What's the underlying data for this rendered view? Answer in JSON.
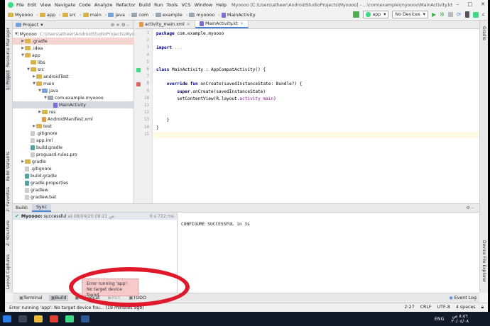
{
  "menubar": {
    "items": [
      "File",
      "Edit",
      "View",
      "Navigate",
      "Code",
      "Analyze",
      "Refactor",
      "Build",
      "Run",
      "Tools",
      "VCS",
      "Window",
      "Help"
    ],
    "title": "Myoooo [C:\\Users\\atheer\\AndroidStudioProjects\\Myoooo] - ...\\com\\example\\myoooo\\MainActivity.kt",
    "controls": [
      "–",
      "□",
      "✕"
    ]
  },
  "navbar": {
    "crumbs": [
      "Myoooo",
      "app",
      "src",
      "main",
      "java",
      "com",
      "example",
      "myoooo",
      "MainActivity"
    ],
    "run_config": "app",
    "device": "No Devices"
  },
  "project_panel": {
    "header": "Project",
    "tree": [
      {
        "label": "Myoooo",
        "extra": "C:\\Users\\atheer\\AndroidStudioProjects\\Myo",
        "depth": 0,
        "open": true,
        "kind": "folder"
      },
      {
        "label": ".gradle",
        "depth": 1,
        "open": false,
        "kind": "folder",
        "highlight": true
      },
      {
        "label": ".idea",
        "depth": 1,
        "open": false,
        "kind": "folder"
      },
      {
        "label": "app",
        "depth": 1,
        "open": true,
        "kind": "folder"
      },
      {
        "label": "libs",
        "depth": 2,
        "open": null,
        "kind": "folder"
      },
      {
        "label": "src",
        "depth": 2,
        "open": true,
        "kind": "folder"
      },
      {
        "label": "androidTest",
        "depth": 3,
        "open": false,
        "kind": "folder"
      },
      {
        "label": "main",
        "depth": 3,
        "open": true,
        "kind": "folder"
      },
      {
        "label": "java",
        "depth": 4,
        "open": true,
        "kind": "folder-blue"
      },
      {
        "label": "com.example.myoooo",
        "depth": 5,
        "open": true,
        "kind": "folder-grey"
      },
      {
        "label": "MainActivity",
        "depth": 6,
        "open": null,
        "kind": "kt",
        "selected": true
      },
      {
        "label": "res",
        "depth": 4,
        "open": false,
        "kind": "folder"
      },
      {
        "label": "AndroidManifest.xml",
        "depth": 4,
        "open": null,
        "kind": "xml"
      },
      {
        "label": "test",
        "depth": 3,
        "open": false,
        "kind": "folder"
      },
      {
        "label": ".gitignore",
        "depth": 2,
        "open": null,
        "kind": "file"
      },
      {
        "label": "app.iml",
        "depth": 2,
        "open": null,
        "kind": "file"
      },
      {
        "label": "build.gradle",
        "depth": 2,
        "open": null,
        "kind": "gradle"
      },
      {
        "label": "proguard-rules.pro",
        "depth": 2,
        "open": null,
        "kind": "file"
      },
      {
        "label": "gradle",
        "depth": 1,
        "open": false,
        "kind": "folder"
      },
      {
        "label": ".gitignore",
        "depth": 1,
        "open": null,
        "kind": "file"
      },
      {
        "label": "build.gradle",
        "depth": 1,
        "open": null,
        "kind": "gradle"
      },
      {
        "label": "gradle.properties",
        "depth": 1,
        "open": null,
        "kind": "gradle"
      },
      {
        "label": "gradlew",
        "depth": 1,
        "open": null,
        "kind": "file"
      },
      {
        "label": "gradlew.bat",
        "depth": 1,
        "open": null,
        "kind": "file"
      }
    ]
  },
  "left_strip": [
    "Resource Manager",
    "1: Project",
    "Build Variants",
    "2: Favorites",
    "Z: Structure",
    "Layout Captures"
  ],
  "right_strip": [
    "Gradle",
    "Device File Explorer"
  ],
  "editor": {
    "tabs": [
      {
        "label": "activity_main.xml",
        "active": false
      },
      {
        "label": "MainActivity.kt",
        "active": true
      }
    ],
    "line_numbers": [
      "1",
      "2",
      "3",
      "4",
      "5",
      "6",
      "7",
      "8",
      "9",
      "10",
      "11",
      "12",
      "13",
      "14",
      "15"
    ],
    "lines": [
      {
        "n": 1,
        "parts": [
          [
            "kw",
            "package "
          ],
          [
            "",
            "com.example.myoooo"
          ]
        ]
      },
      {
        "n": 2,
        "parts": []
      },
      {
        "n": 3,
        "parts": [
          [
            "kw",
            "import "
          ],
          [
            "grey",
            "..."
          ]
        ]
      },
      {
        "n": 4,
        "parts": []
      },
      {
        "n": 5,
        "parts": []
      },
      {
        "n": 6,
        "parts": [
          [
            "kw",
            "class "
          ],
          [
            "",
            "MainActivity : AppCompatActivity() {"
          ]
        ]
      },
      {
        "n": 7,
        "parts": []
      },
      {
        "n": 8,
        "parts": [
          [
            "",
            "    "
          ],
          [
            "kw",
            "override fun "
          ],
          [
            "",
            "onCreate(savedInstanceState: Bundle?) {"
          ]
        ]
      },
      {
        "n": 9,
        "parts": [
          [
            "",
            "        "
          ],
          [
            "kw",
            "super"
          ],
          [
            "",
            ".onCreate(savedInstanceState)"
          ]
        ]
      },
      {
        "n": 10,
        "parts": [
          [
            "",
            "        setContentView(R.layout."
          ],
          [
            "pur",
            "activity_main"
          ],
          [
            "",
            ")"
          ]
        ]
      },
      {
        "n": 11,
        "parts": []
      },
      {
        "n": 12,
        "parts": []
      },
      {
        "n": 13,
        "parts": [
          [
            "",
            "    }"
          ]
        ]
      },
      {
        "n": 14,
        "parts": [
          [
            "",
            "}"
          ]
        ]
      },
      {
        "n": 15,
        "parts": []
      }
    ]
  },
  "build_panel": {
    "label": "Build:",
    "tab": "Sync",
    "sync_project": "Myoooo:",
    "sync_status": "successful",
    "sync_time": "at 08/04/20 08:21 ص",
    "sync_duration": "6 s 722 ms",
    "console": "CONFIGURE SUCCESSFUL in 3s"
  },
  "tool_windows": {
    "items": [
      {
        "label": "Terminal",
        "active": false
      },
      {
        "label": "Build",
        "active": true
      },
      {
        "label": "6: Logcat",
        "active": false
      },
      {
        "label": "Run",
        "active": false,
        "disabled": true
      },
      {
        "label": "TODO",
        "active": false
      }
    ],
    "event_log": "Event Log"
  },
  "tooltip": {
    "line1": "Error running 'app':",
    "line2": "No target device found."
  },
  "status_bar": {
    "message": "Error running 'app': No target device fou... (19 minutes ago)",
    "position": "2:27",
    "line_sep": "CRLF",
    "encoding": "UTF-8",
    "indent": "4 spaces"
  },
  "taskbar": {
    "time": "٨:٥٦ ص",
    "date": "٢٠/٠٤/٠٨",
    "lang": "ENG"
  },
  "colors": {
    "annotation_circle": "#e0192a",
    "selection": "#d5d9e0",
    "keyword": "#000080"
  }
}
